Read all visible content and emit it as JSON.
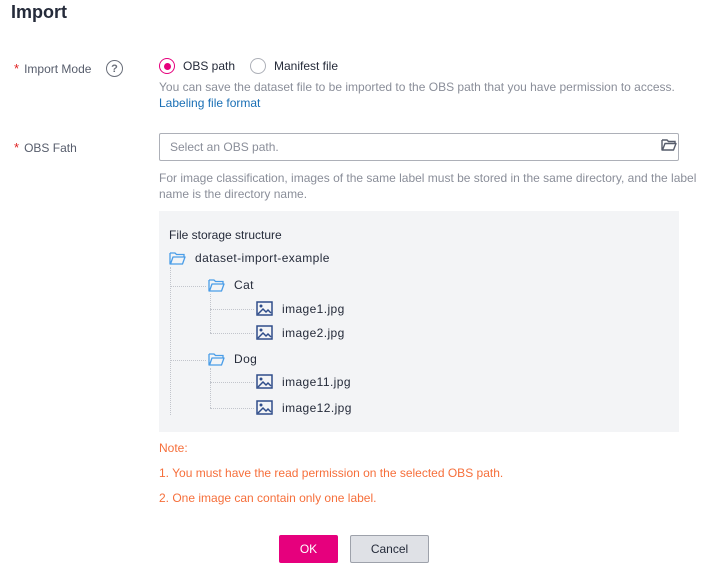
{
  "dialog": {
    "title": "Import"
  },
  "import_mode": {
    "label": "Import Mode",
    "required_mark": "*",
    "help_icon": "question-circle-icon",
    "help_glyph": "?",
    "options": [
      {
        "label": "OBS path",
        "checked": true
      },
      {
        "label": "Manifest file",
        "checked": false
      }
    ],
    "hint": "You can save the dataset file to be imported to the OBS path that you have permission to access.",
    "link": "Labeling file format"
  },
  "obs_path": {
    "label": "OBS Fath",
    "required_mark": "*",
    "placeholder": "Select an OBS path.",
    "folder_icon": "folder-open-icon",
    "hint_line1": "For image classification, images of the same label must be stored in the same directory, and the label",
    "hint_line2": "name is the directory name."
  },
  "structure": {
    "title": "File storage structure",
    "root": "dataset-import-example",
    "folders": [
      {
        "name": "Cat",
        "files": [
          "image1.jpg",
          "image2.jpg"
        ]
      },
      {
        "name": "Dog",
        "files": [
          "image11.jpg",
          "image12.jpg"
        ]
      }
    ]
  },
  "notes": {
    "heading": "Note:",
    "items": [
      "1. You must have the read permission on the selected OBS path.",
      "2. One image can contain only one label."
    ]
  },
  "buttons": {
    "ok": "OK",
    "cancel": "Cancel"
  },
  "colors": {
    "accent": "#e6007d",
    "link": "#1a6fb5",
    "note": "#f66f3b",
    "folder": "#4a9de8",
    "image_icon": "#2f4d8a"
  }
}
